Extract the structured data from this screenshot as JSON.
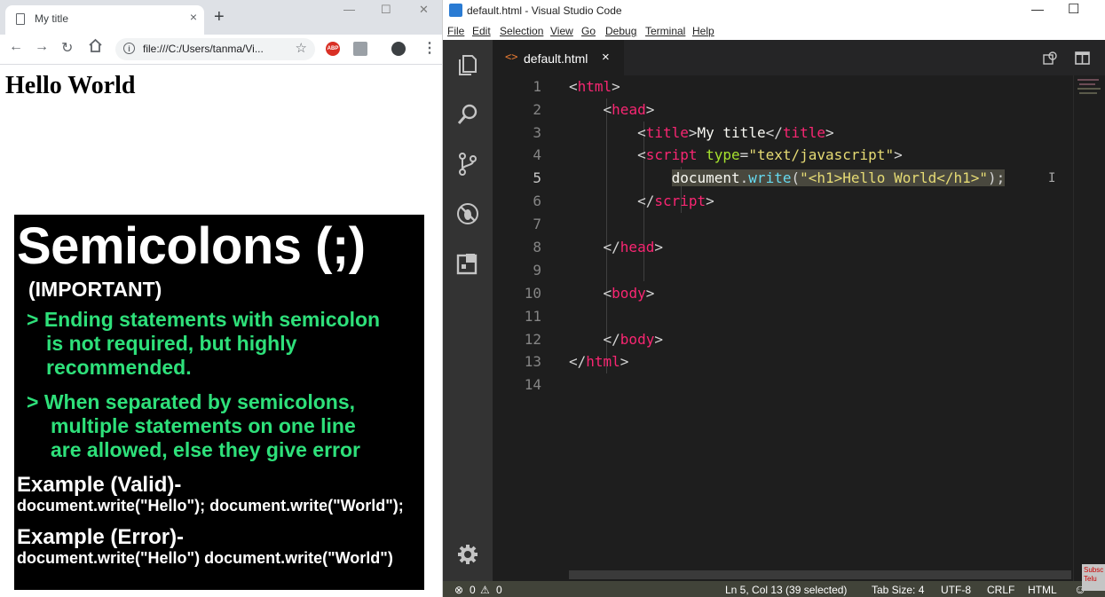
{
  "browser": {
    "tab_title": "My title",
    "new_tab": "+",
    "tab_close": "×",
    "win_minimize": "—",
    "win_maximize": "☐",
    "win_close": "✕",
    "url": "file:///C:/Users/tanma/Vi...",
    "ext_abp": "ABP",
    "page_heading": "Hello World",
    "slide": {
      "title": "Semicolons (;)",
      "subtitle": "(IMPORTANT)",
      "point1_lines": [
        "> Ending statements with semicolon",
        "is not required, but highly",
        "recommended."
      ],
      "point2_lines": [
        "> When separated by semicolons,",
        "multiple statements on one line",
        "are allowed, else they give error"
      ],
      "example_valid_title": "Example (Valid)-",
      "example_valid_code": "document.write(\"Hello\"); document.write(\"World\");",
      "example_error_title": "Example (Error)-",
      "example_error_code": "document.write(\"Hello\") document.write(\"World\")"
    }
  },
  "vscode": {
    "title": "default.html - Visual Studio Code",
    "menu": [
      "File",
      "Edit",
      "Selection",
      "View",
      "Go",
      "Debug",
      "Terminal",
      "Help"
    ],
    "tab_icon": "<>",
    "tab_name": "default.html",
    "tab_close": "×",
    "line_numbers": [
      "1",
      "2",
      "3",
      "4",
      "5",
      "6",
      "7",
      "8",
      "9",
      "10",
      "11",
      "12",
      "13",
      "14"
    ],
    "status": {
      "errors": "0",
      "warnings": "0",
      "position": "Ln 5, Col 13 (39 selected)",
      "tab_size": "Tab Size: 4",
      "encoding": "UTF-8",
      "eol": "CRLF",
      "language": "HTML"
    },
    "corner_text": "Subsc Telu"
  },
  "colors": {
    "tag": "#f92672",
    "attribute": "#a6e22e",
    "string": "#e6db74",
    "function": "#66d9ef",
    "slide_green": "#2ee07a",
    "statusbar": "#414339"
  }
}
